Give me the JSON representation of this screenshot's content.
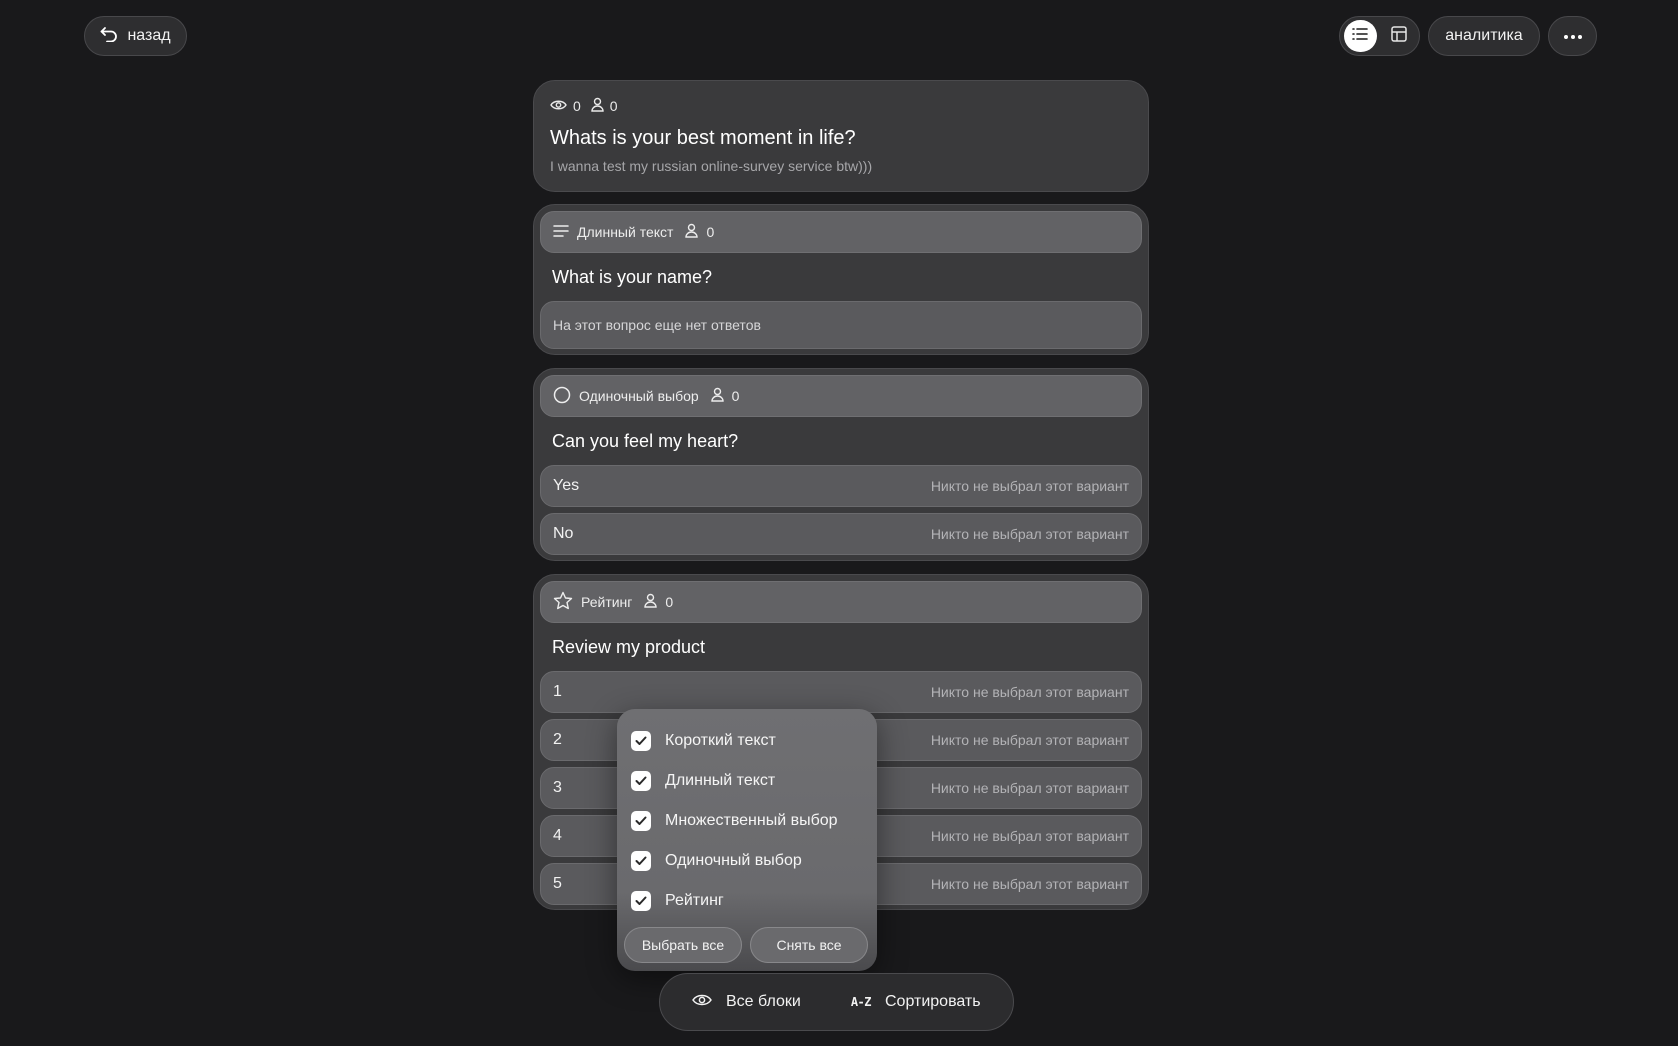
{
  "nav": {
    "back_label": "назад",
    "analytics_label": "аналитика",
    "view_modes": [
      "list-view",
      "grid-view"
    ],
    "active_view": "list-view"
  },
  "survey": {
    "views": "0",
    "respondents": "0",
    "title": "Whats is your best moment in life?",
    "description": "I wanna test my russian online-survey service btw)))"
  },
  "questions": [
    {
      "type_label": "Длинный текст",
      "type_icon": "long-text-icon",
      "respondents": "0",
      "title": "What is your name?",
      "empty_text": "На этот вопрос еще нет ответов"
    },
    {
      "type_label": "Одиночный выбор",
      "type_icon": "radio-icon",
      "respondents": "0",
      "title": "Can you feel my heart?",
      "options": [
        {
          "label": "Yes",
          "note": "Никто не выбрал этот вариант"
        },
        {
          "label": "No",
          "note": "Никто не выбрал этот вариант"
        }
      ]
    },
    {
      "type_label": "Рейтинг",
      "type_icon": "star-icon",
      "respondents": "0",
      "title": "Review my product",
      "options": [
        {
          "label": "1",
          "note": "Никто не выбрал этот вариант"
        },
        {
          "label": "2",
          "note": "Никто не выбрал этот вариант"
        },
        {
          "label": "3",
          "note": "Никто не выбрал этот вариант"
        },
        {
          "label": "4",
          "note": "Никто не выбрал этот вариант"
        },
        {
          "label": "5",
          "note": "Никто не выбрал этот вариант"
        }
      ]
    }
  ],
  "filter_menu": {
    "items": [
      {
        "label": "Короткий текст",
        "checked": true
      },
      {
        "label": "Длинный текст",
        "checked": true
      },
      {
        "label": "Множественный выбор",
        "checked": true
      },
      {
        "label": "Одиночный выбор",
        "checked": true
      },
      {
        "label": "Рейтинг",
        "checked": true
      }
    ],
    "select_all_label": "Выбрать все",
    "clear_all_label": "Снять все"
  },
  "bottom_bar": {
    "blocks_label": "Все блоки",
    "sort_icon_text": "A-Z",
    "sort_label": "Сортировать"
  }
}
